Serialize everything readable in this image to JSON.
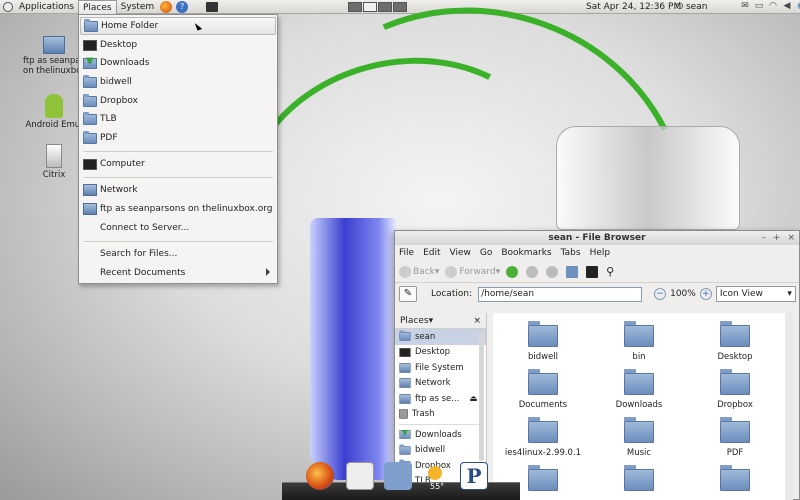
{
  "top_panel": {
    "applications": "Applications",
    "places": "Places",
    "system": "System",
    "clock": "Sat Apr 24, 12:36 PM",
    "user": "sean"
  },
  "desktop_icons": [
    {
      "label": "ftp as seanparsons on thelinuxbox.org",
      "short": "ftp as seanpars\non thelinuxbox"
    },
    {
      "label": "Android Emulator",
      "short": "Android Emul"
    },
    {
      "label": "Citrix",
      "short": "Citrix"
    }
  ],
  "places_menu": {
    "items": [
      {
        "label": "Home Folder",
        "icon": "home-folder-icon"
      },
      {
        "label": "Desktop",
        "icon": "desktop-icon"
      },
      {
        "label": "Downloads",
        "icon": "downloads-icon"
      },
      {
        "label": "bidwell",
        "icon": "folder-icon"
      },
      {
        "label": "Dropbox",
        "icon": "folder-icon"
      },
      {
        "label": "TLB",
        "icon": "folder-icon"
      },
      {
        "label": "PDF",
        "icon": "folder-icon"
      },
      {
        "label": "Computer",
        "icon": "computer-icon"
      },
      {
        "label": "Network",
        "icon": "network-icon"
      },
      {
        "label": "ftp as seanparsons on thelinuxbox.org",
        "icon": "network-share-icon"
      },
      {
        "label": "Connect to Server...",
        "icon": ""
      },
      {
        "label": "Search for Files...",
        "icon": ""
      },
      {
        "label": "Recent Documents",
        "icon": ""
      }
    ]
  },
  "file_browser": {
    "title": "sean - File Browser",
    "menubar": [
      "File",
      "Edit",
      "View",
      "Go",
      "Bookmarks",
      "Tabs",
      "Help"
    ],
    "toolbar": {
      "back": "Back",
      "forward": "Forward"
    },
    "location_label": "Location:",
    "location_value": "/home/sean",
    "zoom_level": "100%",
    "view_mode": "Icon View",
    "side_pane_title": "Places",
    "side_items": [
      {
        "label": "sean",
        "selected": true
      },
      {
        "label": "Desktop"
      },
      {
        "label": "File System"
      },
      {
        "label": "Network"
      },
      {
        "label": "ftp as se..."
      },
      {
        "label": "Trash"
      },
      {
        "label": "Downloads"
      },
      {
        "label": "bidwell"
      },
      {
        "label": "Dropbox"
      },
      {
        "label": "TLB"
      }
    ],
    "files": [
      {
        "name": "bidwell"
      },
      {
        "name": "bin"
      },
      {
        "name": "Desktop"
      },
      {
        "name": "Documents"
      },
      {
        "name": "Downloads"
      },
      {
        "name": "Dropbox"
      },
      {
        "name": "ies4linux-2.99.0.1"
      },
      {
        "name": "Music"
      },
      {
        "name": "PDF"
      }
    ]
  },
  "dock": {
    "weather": "55°"
  }
}
